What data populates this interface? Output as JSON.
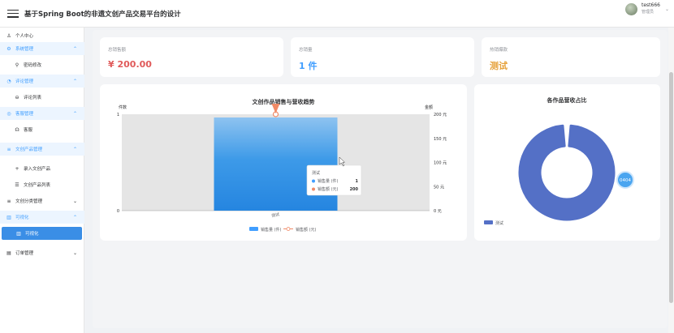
{
  "header": {
    "title": "基于Spring Boot的非遗文创产品交易平台的设计",
    "user_name": "test666",
    "user_role": "管理员"
  },
  "sidebar": {
    "items": [
      {
        "label": "个人中心",
        "icon": "user-icon",
        "kind": "top"
      },
      {
        "label": "系统管理",
        "icon": "gear-icon",
        "kind": "group-open"
      },
      {
        "label": "密码修改",
        "icon": "key-icon",
        "kind": "sub"
      },
      {
        "label": "评论管理",
        "icon": "comment-icon",
        "kind": "group-open"
      },
      {
        "label": "评论列表",
        "icon": "list-circle-icon",
        "kind": "sub"
      },
      {
        "label": "客服管理",
        "icon": "service-icon",
        "kind": "group-open"
      },
      {
        "label": "客服",
        "icon": "headset-icon",
        "kind": "sub"
      },
      {
        "label": "文创产品管理",
        "icon": "menu-icon",
        "kind": "group-open"
      },
      {
        "label": "录入文创产品",
        "icon": "plus-icon",
        "kind": "sub"
      },
      {
        "label": "文创产品列表",
        "icon": "list-icon",
        "kind": "sub"
      },
      {
        "label": "文创分类管理",
        "icon": "menu-icon",
        "kind": "group-closed"
      },
      {
        "label": "可视化",
        "icon": "bar-chart-icon",
        "kind": "group-open"
      },
      {
        "label": "可视化",
        "icon": "bar-chart-icon",
        "kind": "active"
      },
      {
        "label": "订单管理",
        "icon": "order-icon",
        "kind": "group-closed"
      }
    ]
  },
  "stats": [
    {
      "label": "总销售额",
      "value": "¥ 200.00",
      "color": "#e05a5a"
    },
    {
      "label": "总销量",
      "value": "1 件",
      "color": "#409eff"
    },
    {
      "label": "热销爆款",
      "value": "测试",
      "color": "#e6a23c"
    }
  ],
  "chart_data": [
    {
      "type": "bar",
      "title": "文创作品销售与营收趋势",
      "categories": [
        "测试"
      ],
      "series": [
        {
          "name": "销售量 (件)",
          "values": [
            1
          ],
          "color": "#409eff",
          "axis": "left"
        },
        {
          "name": "销售额 (元)",
          "values": [
            200
          ],
          "color": "#f08a66",
          "axis": "right",
          "kind": "line"
        }
      ],
      "ylabel_left": "件数",
      "ylabel_right": "金额",
      "ylim_left": [
        0,
        1
      ],
      "ylim_right": [
        0,
        200
      ],
      "left_ticks": [
        "1",
        "0"
      ],
      "right_ticks": [
        "200 元",
        "150 元",
        "100 元",
        "50 元",
        "0 元"
      ],
      "legend_position": "bottom",
      "tooltip": {
        "title": "测试",
        "rows": [
          {
            "name": "销售量 (件)",
            "value": "1"
          },
          {
            "name": "销售额 (元)",
            "value": "200"
          }
        ]
      }
    },
    {
      "type": "pie",
      "title": "各作品营收占比",
      "slices": [
        {
          "name": "测试",
          "value": 200,
          "color": "#5470c6"
        }
      ],
      "badge": "0404",
      "legend_position": "bottom-left"
    }
  ]
}
